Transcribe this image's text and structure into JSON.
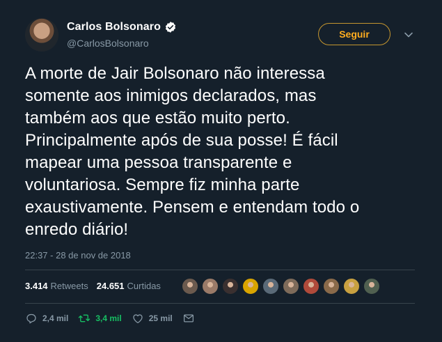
{
  "author": {
    "display_name": "Carlos Bolsonaro",
    "handle": "@CarlosBolsonaro",
    "verified": true
  },
  "header": {
    "follow_label": "Seguir"
  },
  "tweet": {
    "text_lines": [
      "A morte de Jair Bolsonaro não interessa",
      "somente aos inimigos declarados, mas",
      "também aos que estão muito perto.",
      "Principalmente após de sua posse! É fácil",
      "mapear uma pessoa transparente e",
      "voluntariosa. Sempre fiz minha parte",
      "exaustivamente. Pensem e entendam todo o",
      "enredo diário!"
    ],
    "timestamp": "22:37 - 28 de nov de 2018"
  },
  "stats": {
    "retweets_count": "3.414",
    "retweets_label": "Retweets",
    "likes_count": "24.651",
    "likes_label": "Curtidas"
  },
  "liker_faces": [
    {
      "color": "#6b5a4e"
    },
    {
      "color": "#9a7a68"
    },
    {
      "color": "#3a3030"
    },
    {
      "color": "#d9a400"
    },
    {
      "color": "#5a6a78"
    },
    {
      "color": "#7e6b5a"
    },
    {
      "color": "#b04a3a"
    },
    {
      "color": "#8a6a4a"
    },
    {
      "color": "#c8a040"
    },
    {
      "color": "#506050"
    }
  ],
  "actions": {
    "reply_count": "2,4 mil",
    "retweet_count": "3,4 mil",
    "like_count": "25 mil"
  },
  "colors": {
    "background": "#15202b",
    "accent_follow": "#ffad1f",
    "retweet_green": "#17bf63",
    "muted": "#8899a6"
  }
}
